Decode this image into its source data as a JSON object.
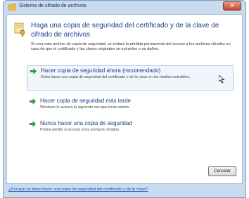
{
  "window": {
    "title": "Sistema de cifrado de archivos",
    "close_label": "✕"
  },
  "header": {
    "title": "Haga una copia de seguridad del certificado y de la clave de cifrado de archivos",
    "description": "Si crea este archivo de copia de seguridad, se evitará la pérdida permanente del acceso a los archivos cifrados en caso de que el certificado y las claves originales se extravíen o se dañen."
  },
  "options": [
    {
      "title": "Hacer copia de seguridad ahora (recomendado)",
      "subtitle": "Debe hacer una copia de seguridad del certificado y de la clave en los medios extraíbles."
    },
    {
      "title": "Hacer copia de seguridad más tarde",
      "subtitle": "Windows le avisará la siguiente vez que inicie sesión."
    },
    {
      "title": "Nunca hacer una copia de seguridad",
      "subtitle": "Podría perder el acceso a los archivos cifrados."
    }
  ],
  "buttons": {
    "cancel": "Cancelar"
  },
  "footer": {
    "help_link": "¿Por qué se debe hacer una copia de seguridad del certificado y de la clave?"
  },
  "colors": {
    "accent": "#1e3d8b",
    "option_arrow": "#2e9a3a",
    "link": "#1a4fb0"
  },
  "icons": {
    "title_icon": "folder-icon",
    "header_icon": "certificate-key-icon",
    "option_arrow": "green-arrow-icon"
  }
}
